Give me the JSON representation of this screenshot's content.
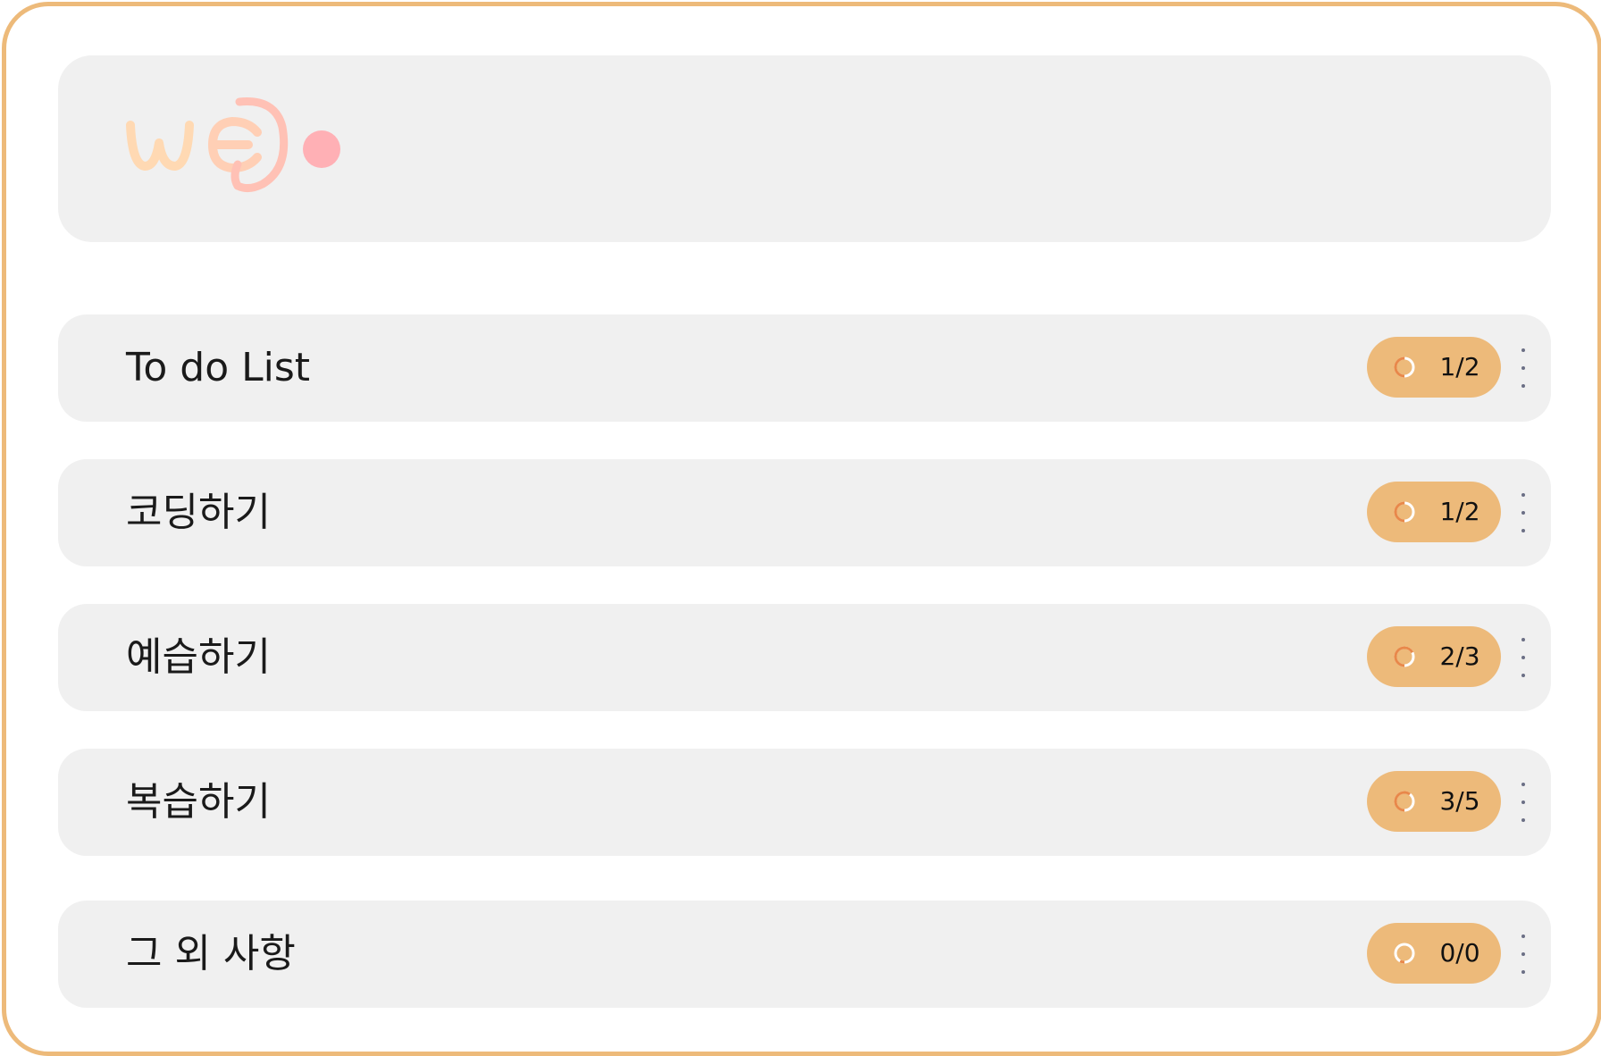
{
  "colors": {
    "frame_border": "#EDBA7A",
    "card_background": "#F0F0F0",
    "badge_background": "#EDBA7A",
    "logo_peach": "#FFD9B3",
    "logo_pink": "#FFB0B5"
  },
  "logo": {
    "icon": "logo-icon"
  },
  "categories": [
    {
      "title": "To do List",
      "count": "1/2",
      "progress": 0.5
    },
    {
      "title": "코딩하기",
      "count": "1/2",
      "progress": 0.5
    },
    {
      "title": "예습하기",
      "count": "2/3",
      "progress": 0.667
    },
    {
      "title": "복습하기",
      "count": "3/5",
      "progress": 0.6
    },
    {
      "title": "그 외 사항",
      "count": "0/0",
      "progress": 0
    }
  ],
  "icons": {
    "progress": "progress-ring-icon",
    "more": "more-vertical-icon"
  }
}
